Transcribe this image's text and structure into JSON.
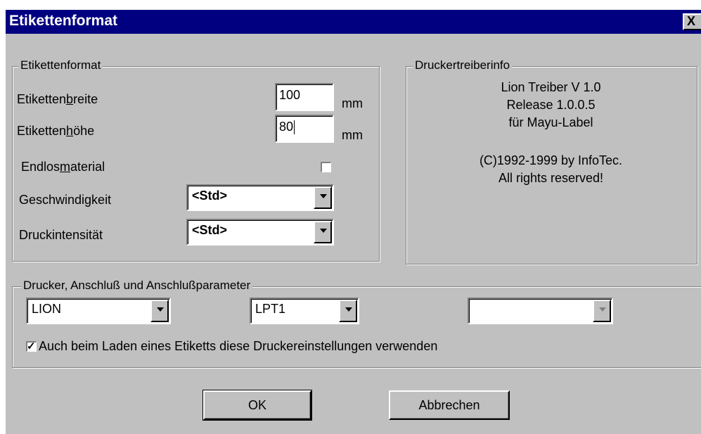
{
  "dialog": {
    "title": "Etikettenformat",
    "close_label": "X"
  },
  "format_group": {
    "legend": "Etikettenformat",
    "width_label_pre": "Etiketten",
    "width_label_key": "b",
    "width_label_post": "reite",
    "width_value": "100",
    "width_unit": "mm",
    "height_label_pre": "Etiketten",
    "height_label_key": "h",
    "height_label_post": "öhe",
    "height_value": "80",
    "height_unit": "mm",
    "endless_label_pre": "Endlos",
    "endless_label_key": "m",
    "endless_label_post": "aterial",
    "endless_checked": false,
    "speed_label": "Geschwindigkeit",
    "speed_value": "<Std>",
    "intensity_label": "Druckintensität",
    "intensity_value": "<Std>"
  },
  "driver_info": {
    "legend": "Druckertreiberinfo",
    "line1": "Lion Treiber V 1.0",
    "line2": "Release 1.0.0.5",
    "line3": "für Mayu-Label",
    "line4": "(C)1992-1999 by InfoTec.",
    "line5": "All rights reserved!"
  },
  "printer_group": {
    "legend": "Drucker, Anschluß und Anschlußparameter",
    "printer_value": "LION",
    "port_value": "LPT1",
    "param_value": "",
    "use_on_load_checked": true,
    "use_on_load_label": "Auch beim Laden eines Etiketts diese Druckereinstellungen verwenden"
  },
  "buttons": {
    "ok_label": "OK",
    "cancel_label": "Abbrechen"
  }
}
